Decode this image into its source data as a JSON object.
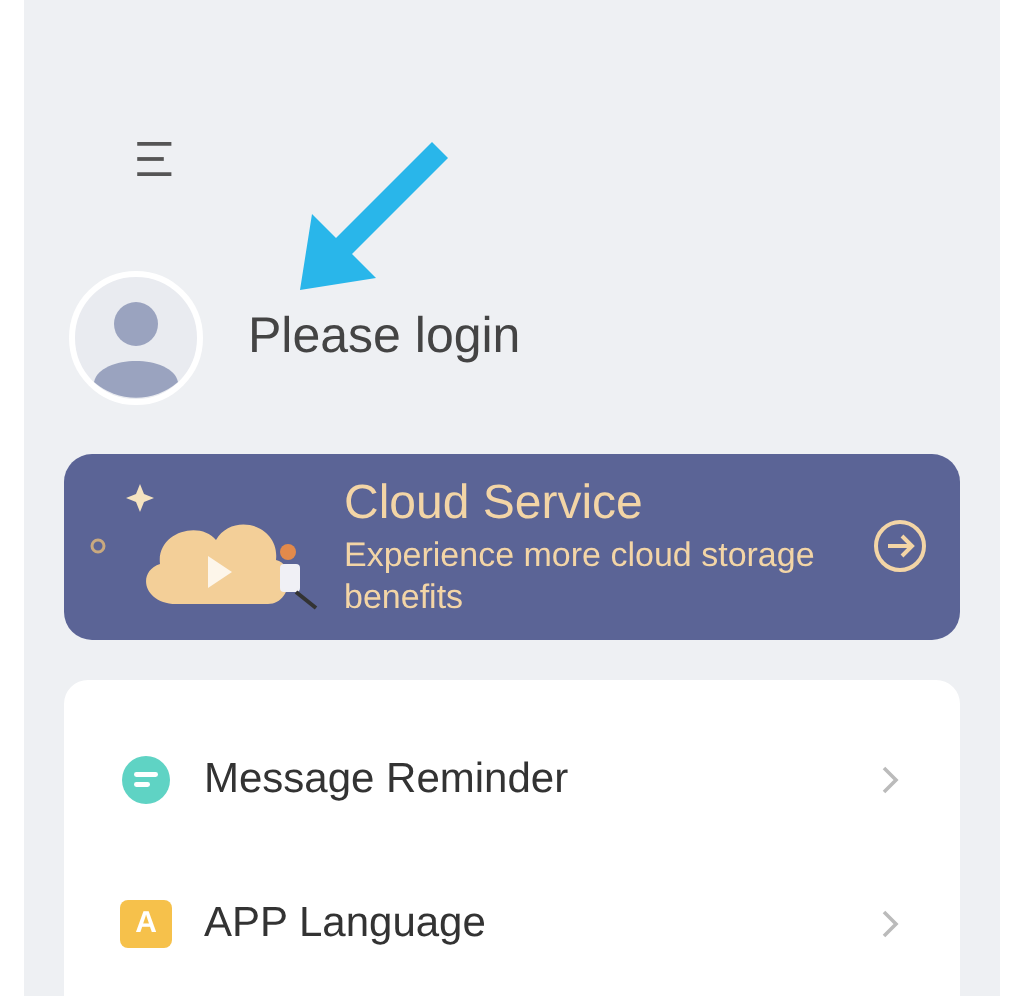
{
  "profile": {
    "login_text": "Please login"
  },
  "banner": {
    "title": "Cloud Service",
    "subtitle": "Experience more cloud storage benefits"
  },
  "menu_items": [
    {
      "kind": "message",
      "label": "Message Reminder"
    },
    {
      "kind": "language",
      "label": "APP Language",
      "icon_letter": "A"
    }
  ]
}
